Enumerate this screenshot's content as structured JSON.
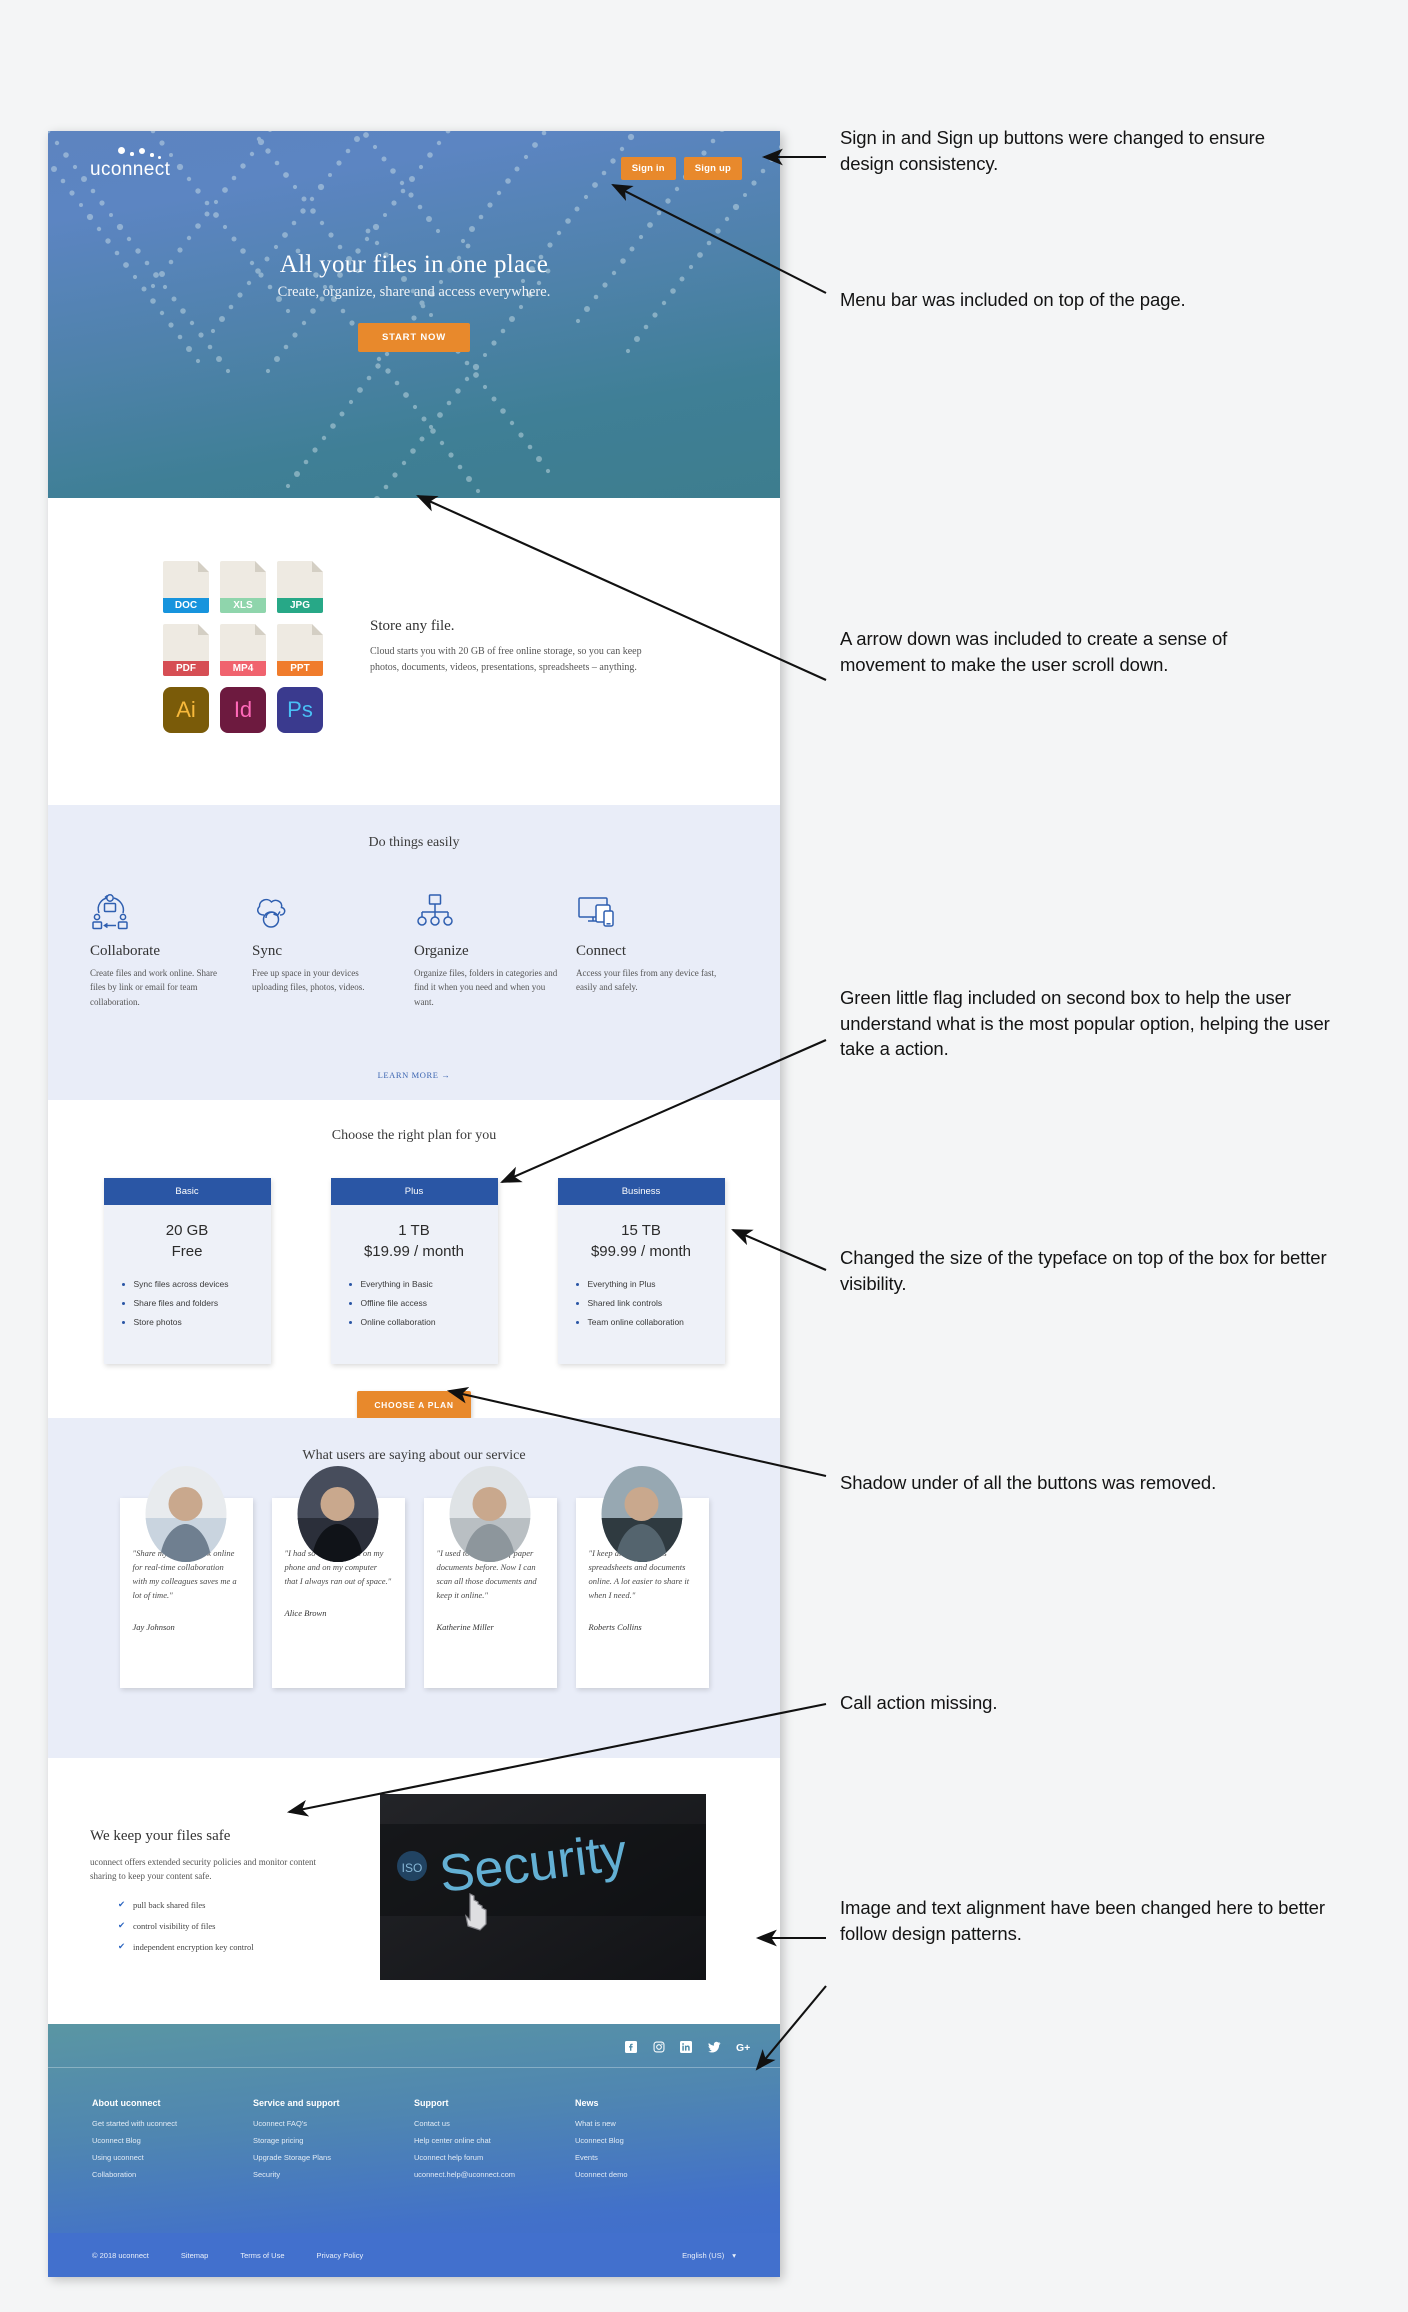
{
  "hero": {
    "logo": "uconnect",
    "sign_in": "Sign in",
    "sign_up": "Sign up",
    "headline": "All your files in one place",
    "subheadline": "Create, organize, share and access everywhere.",
    "cta": "START NOW"
  },
  "store": {
    "title": "Store any file.",
    "body": "Cloud starts you with 20 GB of free online storage, so you can keep photos, documents, videos, presentations, spreadsheets  – anything.",
    "files": [
      {
        "label": "DOC",
        "color": "#1794dd",
        "kind": "doc"
      },
      {
        "label": "XLS",
        "color": "#8fd5ac",
        "kind": "doc"
      },
      {
        "label": "JPG",
        "color": "#27a887",
        "kind": "doc"
      },
      {
        "label": "PDF",
        "color": "#d64e54",
        "kind": "doc"
      },
      {
        "label": "MP4",
        "color": "#f0636e",
        "kind": "doc"
      },
      {
        "label": "PPT",
        "color": "#f07c2c",
        "kind": "doc"
      },
      {
        "label": "Ai",
        "color": "#7a5b09",
        "text": "#f8b93b",
        "kind": "app"
      },
      {
        "label": "Id",
        "color": "#6d1a3f",
        "text": "#ff69b9",
        "kind": "app"
      },
      {
        "label": "Ps",
        "color": "#3a3a8e",
        "text": "#49c0f5",
        "kind": "app"
      }
    ]
  },
  "easy": {
    "title": "Do things easily",
    "learn_more": "LEARN MORE →",
    "features": [
      {
        "icon": "collaborate-icon",
        "title": "Collaborate",
        "body": "Create files and work online. Share files by link or email for team collaboration."
      },
      {
        "icon": "sync-cloud-icon",
        "title": "Sync",
        "body": "Free up space in your devices uploading files, photos, videos."
      },
      {
        "icon": "organize-tree-icon",
        "title": "Organize",
        "body": "Organize files,  folders in categories and  find it when you need and when you want."
      },
      {
        "icon": "connect-devices-icon",
        "title": "Connect",
        "body": "Access your files from any device fast, easily and safely."
      }
    ]
  },
  "pricing": {
    "title": "Choose the right plan for you",
    "cta": "CHOOSE A PLAN",
    "plans": [
      {
        "name": "Basic",
        "size": "20 GB",
        "price": "Free",
        "features": [
          "Sync files across devices",
          "Share files and folders",
          "Store photos"
        ]
      },
      {
        "name": "Plus",
        "size": "1 TB",
        "price": "$19.99 / month",
        "features": [
          "Everything in Basic",
          "Offline file access",
          "Online collaboration"
        ]
      },
      {
        "name": "Business",
        "size": "15 TB",
        "price": "$99.99 / month",
        "features": [
          "Everything in Plus",
          "Shared link controls",
          "Team online collaboration"
        ]
      }
    ]
  },
  "testimonials": {
    "title": "What users are saying about our service",
    "items": [
      {
        "quote": "\"Share my school work online for real-time collaboration with my colleagues saves me a lot of time.\"",
        "author": "Jay Johnson"
      },
      {
        "quote": "\"I had so many photos on my phone and on my computer that I always ran out of space.\"",
        "author": "Alice Brown"
      },
      {
        "quote": "\"I used to lose a lot of paper documents before. Now I can scan all those documents and keep it online.\"",
        "author": "Katherine Miller"
      },
      {
        "quote": "\"I keep all my business spreadsheets and documents online. A lot easier to share it when I need.\"",
        "author": "Roberts Collins"
      }
    ]
  },
  "security": {
    "title": "We keep your files safe",
    "body": "uconnect offers extended security policies and monitor content sharing to keep your content safe.",
    "list": [
      "pull back shared files",
      "control visibility of files",
      "independent encryption key control"
    ],
    "image_text": "Security"
  },
  "footer": {
    "social": [
      "facebook-icon",
      "instagram-icon",
      "linkedin-icon",
      "twitter-icon",
      "googleplus-icon"
    ],
    "columns": [
      {
        "heading": "About uconnect",
        "links": [
          "Get started with uconnect",
          "Uconnect Blog",
          "Using uconnect",
          "Collaboration"
        ]
      },
      {
        "heading": "Service and support",
        "links": [
          "Uconnect FAQ's",
          "Storage pricing",
          "Upgrade Storage Plans",
          "Security"
        ]
      },
      {
        "heading": "Support",
        "links": [
          "Contact us",
          "Help center online chat",
          "Uconnect help forum",
          "uconnect.help@uconnect.com"
        ]
      },
      {
        "heading": "News",
        "links": [
          "What is new",
          "Uconnect Blog",
          "Events",
          "Uconnect demo"
        ]
      }
    ],
    "bottom": {
      "copyright": "© 2018 uconnect",
      "sitemap": "Sitemap",
      "terms": "Terms of Use",
      "privacy": "Privacy Policy",
      "language": "English (US)"
    }
  },
  "annotations": [
    {
      "id": "a1",
      "text": "Sign in and Sign up buttons were changed to ensure design consistency."
    },
    {
      "id": "a2",
      "text": "Menu bar was included on top of the page."
    },
    {
      "id": "a3",
      "text": "A arrow down was included to create a sense of movement to make the user scroll down."
    },
    {
      "id": "a4",
      "text": "Green little flag included on second box to help the user understand what is the most popular option, helping the user take a action."
    },
    {
      "id": "a5",
      "text": "Changed the size of the typeface on top of the box for better visibility."
    },
    {
      "id": "a6",
      "text": "Shadow under of all the buttons was removed."
    },
    {
      "id": "a7",
      "text": "Call action missing."
    },
    {
      "id": "a8",
      "text": "Image and text alignment have been changed here to better follow design patterns."
    }
  ]
}
